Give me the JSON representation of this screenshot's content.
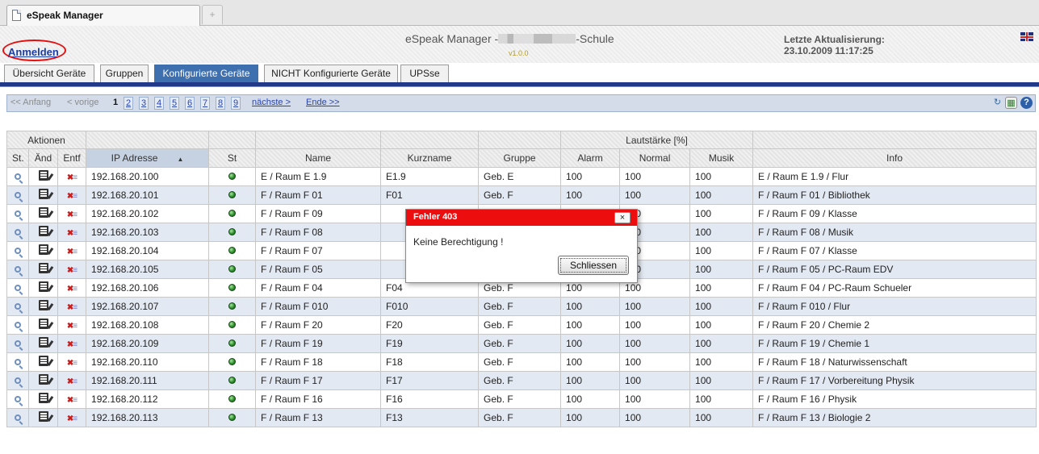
{
  "browser": {
    "tab_title": "eSpeak Manager",
    "new_tab_glyph": "+"
  },
  "header": {
    "login_link": "Anmelden",
    "title_prefix": "eSpeak Manager -",
    "title_suffix": "-Schule",
    "version": "v1.0.0",
    "update_label": "Letzte Aktualisierung:",
    "update_value": "23.10.2009 11:17:25",
    "language_icon": "uk-flag-icon"
  },
  "tabs": [
    {
      "label": "Übersicht Geräte",
      "active": false
    },
    {
      "label": "Gruppen",
      "active": false
    },
    {
      "label": "Konfigurierte Geräte",
      "active": true
    },
    {
      "label": "NICHT Konfigurierte Geräte",
      "active": false
    },
    {
      "label": "UPSse",
      "active": false
    }
  ],
  "pager": {
    "first": "<< Anfang",
    "prev": "< vorige",
    "current": "1",
    "pages": [
      "2",
      "3",
      "4",
      "5",
      "6",
      "7",
      "8",
      "9"
    ],
    "next": "nächste >",
    "last": "Ende >>",
    "icons": [
      "refresh-icon",
      "export-icon",
      "help-icon"
    ]
  },
  "table": {
    "group_headers": {
      "aktionen": "Aktionen",
      "lautstaerke": "Lautstärke [%]"
    },
    "columns": [
      "St.",
      "Änd",
      "Entf",
      "IP Adresse",
      "St",
      "Name",
      "Kurzname",
      "Gruppe",
      "Alarm",
      "Normal",
      "Musik",
      "Info"
    ],
    "rows": [
      {
        "ip": "192.168.20.100",
        "name": "E / Raum E 1.9",
        "kurz": "E1.9",
        "gruppe": "Geb. E",
        "alarm": "100",
        "normal": "100",
        "musik": "100",
        "info": "E / Raum E 1.9 / Flur"
      },
      {
        "ip": "192.168.20.101",
        "name": "F / Raum F 01",
        "kurz": "F01",
        "gruppe": "Geb. F",
        "alarm": "100",
        "normal": "100",
        "musik": "100",
        "info": "F / Raum F 01 / Bibliothek"
      },
      {
        "ip": "192.168.20.102",
        "name": "F / Raum F 09",
        "kurz": "",
        "gruppe": "",
        "alarm": "",
        "normal": "100",
        "musik": "100",
        "info": "F / Raum F 09 / Klasse"
      },
      {
        "ip": "192.168.20.103",
        "name": "F / Raum F 08",
        "kurz": "",
        "gruppe": "",
        "alarm": "",
        "normal": "100",
        "musik": "100",
        "info": "F / Raum F 08 / Musik"
      },
      {
        "ip": "192.168.20.104",
        "name": "F / Raum F 07",
        "kurz": "",
        "gruppe": "",
        "alarm": "",
        "normal": "100",
        "musik": "100",
        "info": "F / Raum F 07 / Klasse"
      },
      {
        "ip": "192.168.20.105",
        "name": "F / Raum F 05",
        "kurz": "",
        "gruppe": "",
        "alarm": "",
        "normal": "100",
        "musik": "100",
        "info": "F / Raum F 05 / PC-Raum EDV"
      },
      {
        "ip": "192.168.20.106",
        "name": "F / Raum F 04",
        "kurz": "F04",
        "gruppe": "Geb. F",
        "alarm": "100",
        "normal": "100",
        "musik": "100",
        "info": "F / Raum F 04 / PC-Raum Schueler"
      },
      {
        "ip": "192.168.20.107",
        "name": "F / Raum F 010",
        "kurz": "F010",
        "gruppe": "Geb. F",
        "alarm": "100",
        "normal": "100",
        "musik": "100",
        "info": "F / Raum F 010 / Flur"
      },
      {
        "ip": "192.168.20.108",
        "name": "F / Raum F 20",
        "kurz": "F20",
        "gruppe": "Geb. F",
        "alarm": "100",
        "normal": "100",
        "musik": "100",
        "info": "F / Raum F 20 / Chemie 2"
      },
      {
        "ip": "192.168.20.109",
        "name": "F / Raum F 19",
        "kurz": "F19",
        "gruppe": "Geb. F",
        "alarm": "100",
        "normal": "100",
        "musik": "100",
        "info": "F / Raum F 19 / Chemie 1"
      },
      {
        "ip": "192.168.20.110",
        "name": "F / Raum F 18",
        "kurz": "F18",
        "gruppe": "Geb. F",
        "alarm": "100",
        "normal": "100",
        "musik": "100",
        "info": "F / Raum F 18 / Naturwissenschaft"
      },
      {
        "ip": "192.168.20.111",
        "name": "F / Raum F 17",
        "kurz": "F17",
        "gruppe": "Geb. F",
        "alarm": "100",
        "normal": "100",
        "musik": "100",
        "info": "F / Raum F 17 / Vorbereitung Physik"
      },
      {
        "ip": "192.168.20.112",
        "name": "F / Raum F 16",
        "kurz": "F16",
        "gruppe": "Geb. F",
        "alarm": "100",
        "normal": "100",
        "musik": "100",
        "info": "F / Raum F 16 / Physik"
      },
      {
        "ip": "192.168.20.113",
        "name": "F / Raum F 13",
        "kurz": "F13",
        "gruppe": "Geb. F",
        "alarm": "100",
        "normal": "100",
        "musik": "100",
        "info": "F / Raum F 13 / Biologie 2"
      }
    ]
  },
  "dialog": {
    "title": "Fehler 403",
    "message": "Keine Berechtigung !",
    "button": "Schliessen",
    "close_glyph": "×"
  },
  "colors": {
    "accent": "#3e6fae",
    "navbar": "#22398a",
    "dialog_header": "#ec0e0e",
    "login_highlight": "#e21010"
  }
}
